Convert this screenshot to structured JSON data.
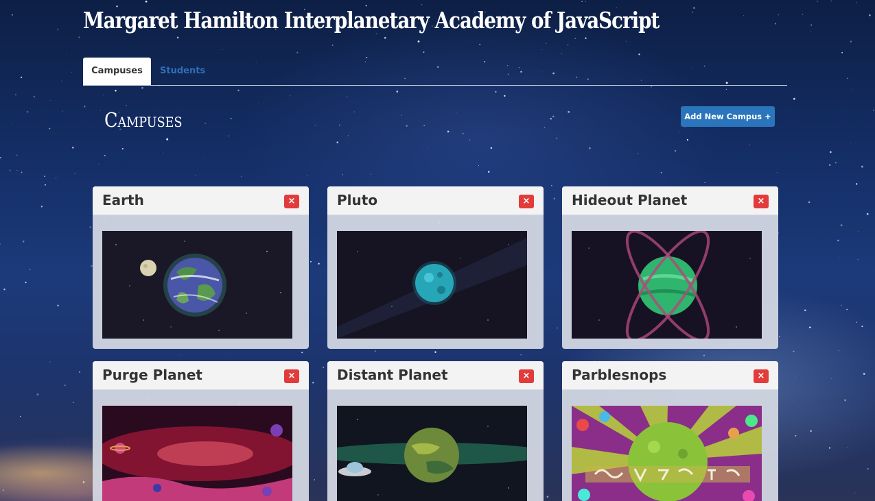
{
  "app": {
    "title": "Margaret Hamilton Interplanetary Academy of JavaScript"
  },
  "tabs": [
    {
      "label": "Campuses",
      "active": true
    },
    {
      "label": "Students",
      "active": false
    }
  ],
  "section": {
    "title": "Campuses",
    "add_button_label": "Add New Campus +"
  },
  "campuses": [
    {
      "name": "Earth",
      "delete_label": "×",
      "image_icon": "earth-planet-image"
    },
    {
      "name": "Pluto",
      "delete_label": "×",
      "image_icon": "pluto-planet-image"
    },
    {
      "name": "Hideout Planet",
      "delete_label": "×",
      "image_icon": "hideout-planet-image"
    },
    {
      "name": "Purge Planet",
      "delete_label": "×",
      "image_icon": "purge-planet-image"
    },
    {
      "name": "Distant Planet",
      "delete_label": "×",
      "image_icon": "distant-planet-image"
    },
    {
      "name": "Parblesnops",
      "delete_label": "×",
      "image_icon": "parblesnops-planet-image"
    }
  ],
  "colors": {
    "accent": "#2a75bb",
    "danger": "#e23b3b",
    "card_body": "#d3d8e2",
    "card_header": "#f3f3f3",
    "tab_link": "#2f6fb6"
  }
}
